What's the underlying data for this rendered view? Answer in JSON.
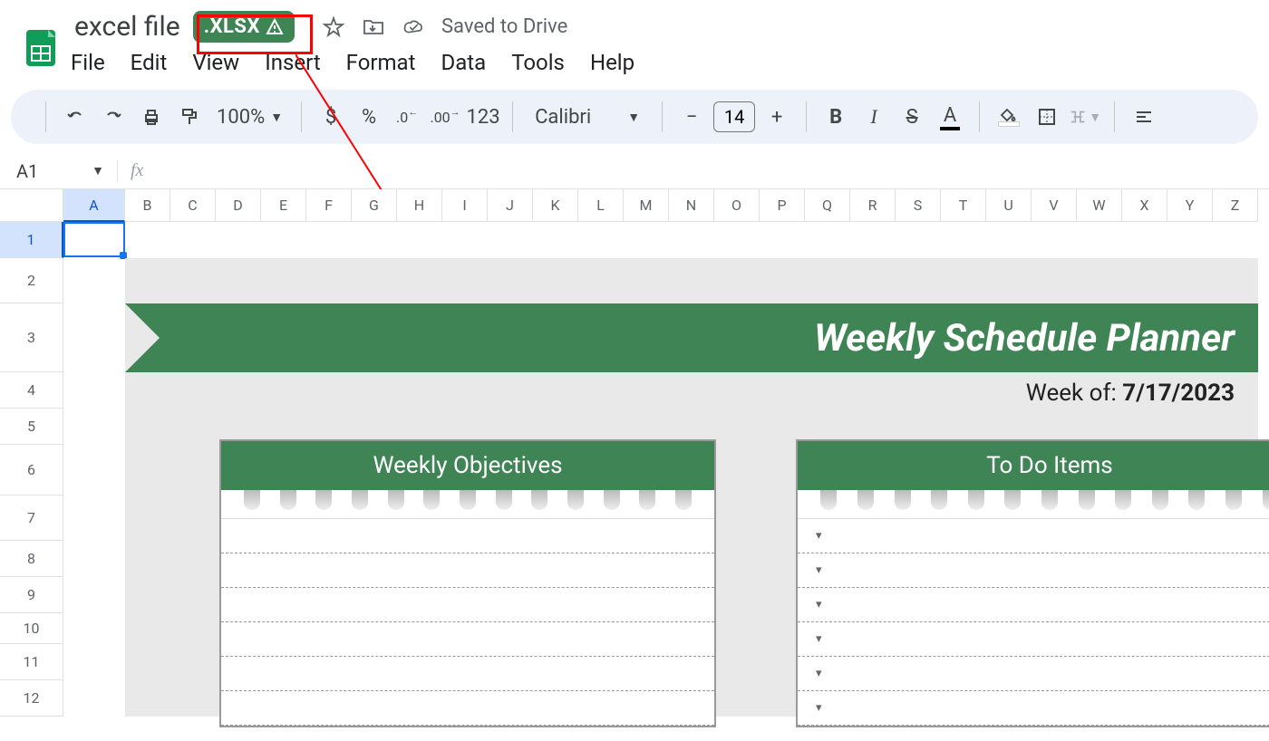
{
  "doc": {
    "title": "excel file",
    "badge": ".XLSX",
    "saved": "Saved to Drive"
  },
  "menu": [
    "File",
    "Edit",
    "View",
    "Insert",
    "Format",
    "Data",
    "Tools",
    "Help"
  ],
  "toolbar": {
    "zoom": "100%",
    "currency": "$",
    "percent": "%",
    "dec_dec": ".0",
    "inc_dec": ".00",
    "numfmt": "123",
    "font": "Calibri",
    "size": "14"
  },
  "namebox": "A1",
  "fx": "fx",
  "columns": [
    "A",
    "B",
    "C",
    "D",
    "E",
    "F",
    "G",
    "H",
    "I",
    "J",
    "K",
    "L",
    "M",
    "N",
    "O",
    "P",
    "Q",
    "R",
    "S",
    "T",
    "U",
    "V",
    "W",
    "X",
    "Y",
    "Z"
  ],
  "rows": [
    "1",
    "2",
    "3",
    "4",
    "5",
    "6",
    "7",
    "8",
    "9",
    "10",
    "11",
    "12"
  ],
  "sheet": {
    "banner_title": "Weekly Schedule Planner",
    "week_of_label": "Week of:",
    "week_of_value": "7/17/2023",
    "panel_left": "Weekly Objectives",
    "panel_right": "To Do Items"
  }
}
